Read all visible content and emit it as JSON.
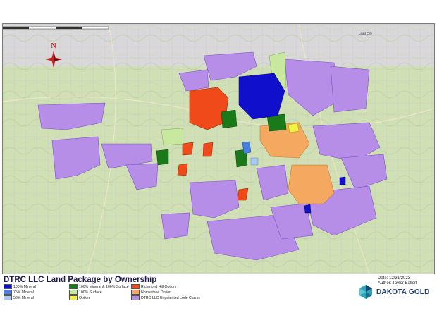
{
  "map": {
    "title": "DTRC LLC Land Package by Ownership",
    "date": "Date: 12/31/2023",
    "author": "Author: Taylor Ballert",
    "north_label": "N",
    "town_label": "Lead City"
  },
  "legend": {
    "items": [
      {
        "label": "100% Mineral",
        "color": "#1010cc"
      },
      {
        "label": "75% Mineral",
        "color": "#4a7fe0"
      },
      {
        "label": "50% Mineral",
        "color": "#a9c8ee"
      },
      {
        "label": "100% Mineral & 100% Surface",
        "color": "#1a7a1a"
      },
      {
        "label": "100% Surface",
        "color": "#c8e8a0"
      },
      {
        "label": "Option",
        "color": "#f4f046"
      },
      {
        "label": "Richmond Hill Option",
        "color": "#f04a1a"
      },
      {
        "label": "Homestake Option",
        "color": "#f4a860"
      },
      {
        "label": "DTRC LLC Unpatented Lode Claims",
        "color": "#b68ee8"
      }
    ]
  },
  "brand": {
    "name": "DAKOTA GOLD"
  }
}
